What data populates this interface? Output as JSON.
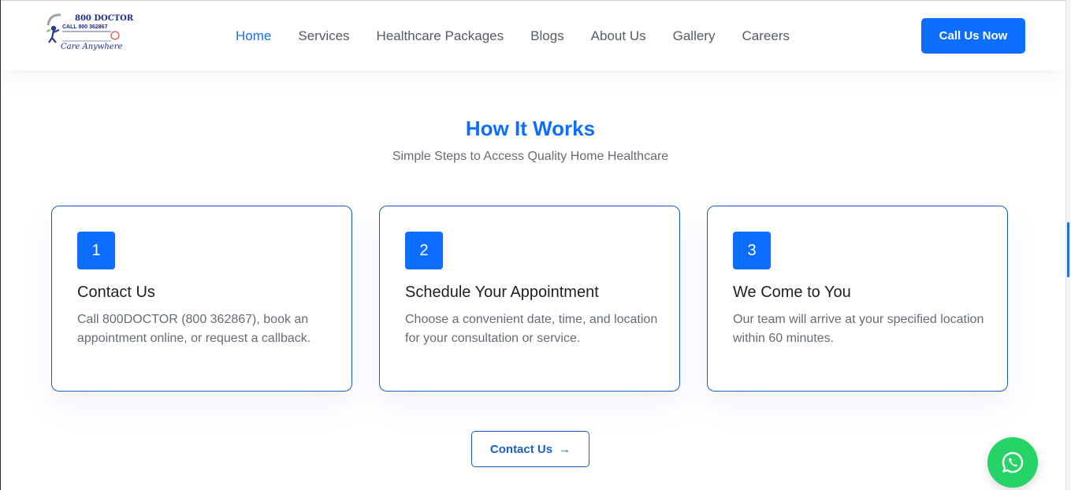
{
  "brand": {
    "logo_line1": "800 DOCTOR",
    "logo_line2": "CALL 800 362867",
    "logo_tagline": "Care Anywhere"
  },
  "nav": {
    "items": [
      {
        "label": "Home",
        "active": true
      },
      {
        "label": "Services",
        "active": false
      },
      {
        "label": "Healthcare Packages",
        "active": false
      },
      {
        "label": "Blogs",
        "active": false
      },
      {
        "label": "About Us",
        "active": false
      },
      {
        "label": "Gallery",
        "active": false
      },
      {
        "label": "Careers",
        "active": false
      }
    ],
    "cta_label": "Call Us Now"
  },
  "section": {
    "title": "How It Works",
    "subtitle": "Simple Steps to Access Quality Home Healthcare",
    "steps": [
      {
        "number": "1",
        "title": "Contact Us",
        "description": "Call 800DOCTOR (800 362867), book an appointment online, or request a callback."
      },
      {
        "number": "2",
        "title": "Schedule Your Appointment",
        "description": "Choose a convenient date, time, and location for your consultation or service."
      },
      {
        "number": "3",
        "title": "We Come to You",
        "description": "Our team will arrive at your specified location within 60 minutes."
      }
    ],
    "button_label": "Contact Us",
    "button_icon": "arrow-right-icon"
  },
  "floating": {
    "whatsapp_icon": "whatsapp-icon"
  },
  "colors": {
    "primary": "#0d6efd",
    "whatsapp": "#25d366",
    "text_dark": "#1d1f22",
    "text_muted": "#666c74"
  }
}
